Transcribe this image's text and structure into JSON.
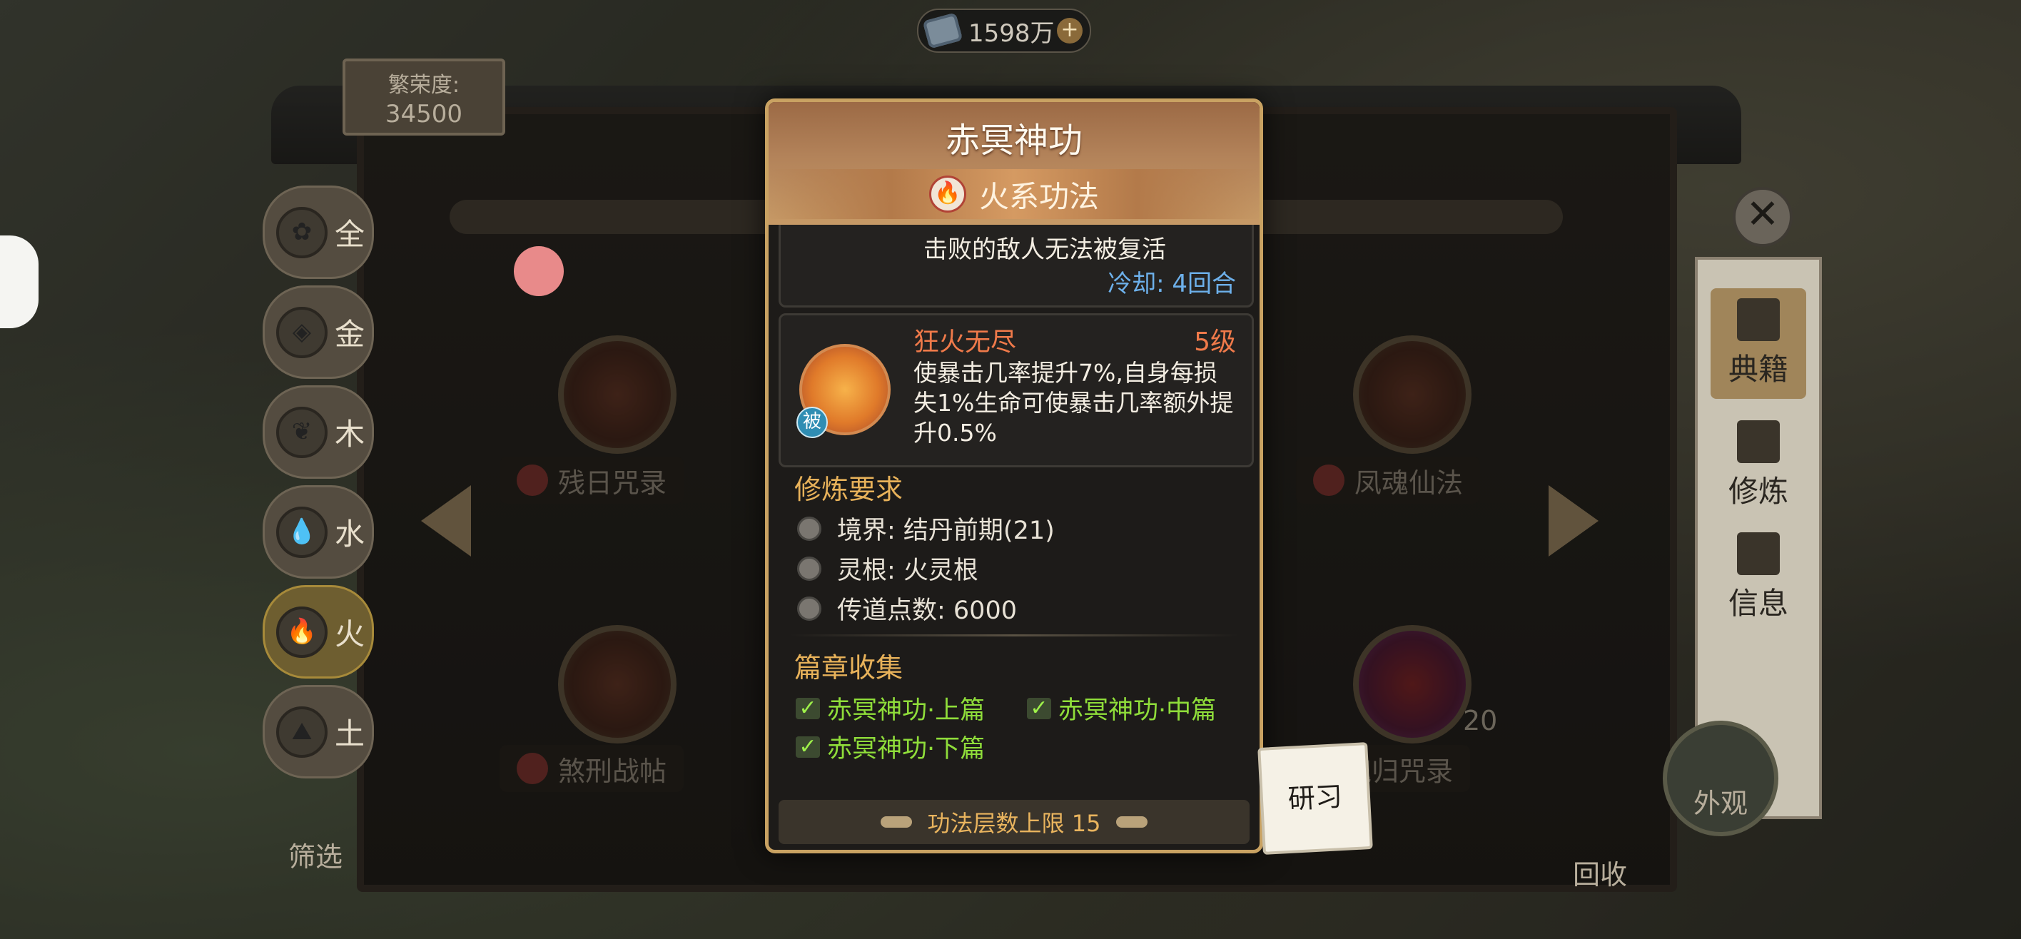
{
  "currency": {
    "value": "1598万",
    "plus": "+"
  },
  "prosperity": {
    "label": "繁荣度:",
    "value": "34500"
  },
  "elements": [
    {
      "label": "全",
      "icon": "all-element-icon"
    },
    {
      "label": "金",
      "icon": "metal-element-icon"
    },
    {
      "label": "木",
      "icon": "wood-element-icon"
    },
    {
      "label": "水",
      "icon": "water-element-icon"
    },
    {
      "label": "火",
      "icon": "fire-element-icon",
      "active": true
    },
    {
      "label": "土",
      "icon": "earth-element-icon"
    }
  ],
  "shelf": {
    "books": [
      "残日咒录",
      "凤魂仙法",
      "煞刑战帖",
      "魂归咒录"
    ],
    "count_badge": "20"
  },
  "right_menu": {
    "items": [
      "典籍",
      "修炼",
      "信息"
    ],
    "close": "✕"
  },
  "bottom": {
    "filter": "筛选",
    "recycle": "回收",
    "appearance": "外观"
  },
  "popup": {
    "title": "赤冥神功",
    "type_label": "火系功法",
    "skill_desc_tail": "击败的敌人无法被复活",
    "cooldown": "冷却: 4回合",
    "passive": {
      "name": "狂火无尽",
      "level": "5级",
      "badge": "被",
      "desc": "使暴击几率提升7%,自身每损失1%生命可使暴击几率额外提升0.5%"
    },
    "requirements_title": "修炼要求",
    "requirements": [
      "境界: 结丹前期(21)",
      "灵根: 火灵根",
      "传道点数: 6000"
    ],
    "chapters_title": "篇章收集",
    "chapters": [
      "赤冥神功·上篇",
      "赤冥神功·中篇",
      "赤冥神功·下篇"
    ],
    "limit": "功法层数上限 15"
  },
  "study_button": "研习"
}
